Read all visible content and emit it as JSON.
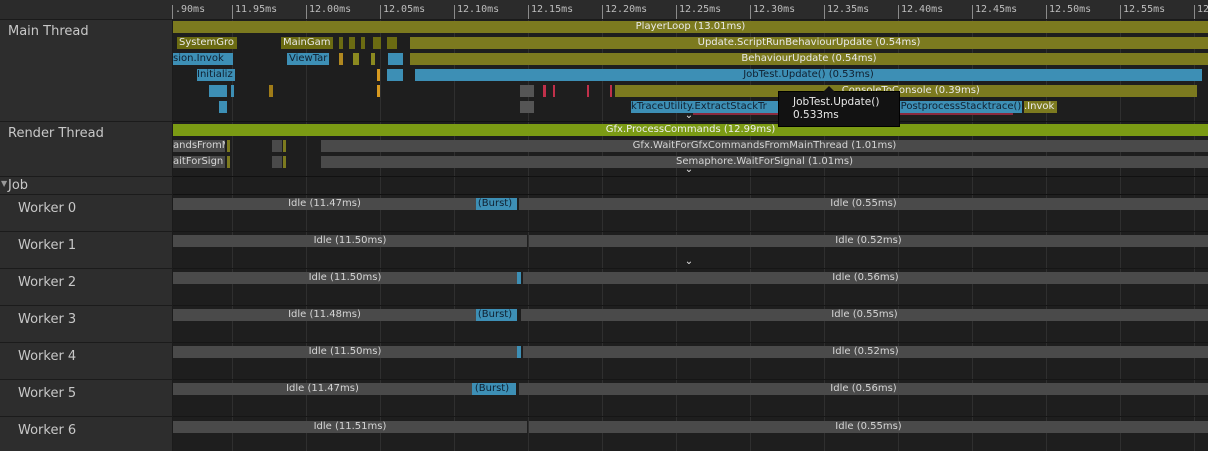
{
  "ruler": {
    "ticks": [
      ".90ms",
      "11.95ms",
      "12.00ms",
      "12.05ms",
      "12.10ms",
      "12.15ms",
      "12.20ms",
      "12.25ms",
      "12.30ms",
      "12.35ms",
      "12.40ms",
      "12.45ms",
      "12.50ms",
      "12.55ms",
      "12"
    ]
  },
  "threads": {
    "main": "Main Thread",
    "render": "Render Thread",
    "job_group": "Job",
    "workers": [
      "Worker 0",
      "Worker 1",
      "Worker 2",
      "Worker 3",
      "Worker 4",
      "Worker 5",
      "Worker 6"
    ]
  },
  "main_thread": {
    "player_loop": "PlayerLoop (13.01ms)",
    "script_run": "Update.ScriptRunBehaviourUpdate (0.54ms)",
    "behaviour_update": "BehaviourUpdate (0.54ms)",
    "job_test_update": "JobTest.Update() (0.53ms)",
    "log_console": "...ConsoleToConsole (0.39ms)",
    "extract_stack": "kTraceUtility.ExtractStackTr",
    "postprocess": "PostprocessStacktrace()",
    "invok_right": ".Invok",
    "system_gro": "SystemGro",
    "main_gam": "MainGam",
    "sion_invok": "sion.Invok",
    "view_tar": "ViewTar",
    "initializ": "Initializ"
  },
  "render_thread": {
    "process_commands": "Gfx.ProcessCommands (12.99ms)",
    "wait_for_commands": "Gfx.WaitForGfxCommandsFromMainThread (1.01ms)",
    "semaphore": "Semaphore.WaitForSignal (1.01ms)",
    "ands_from": "andsFromM",
    "ait_for_sign": "aitForSign"
  },
  "workers": [
    {
      "idle_left": "Idle (11.47ms)",
      "burst": "(Burst)",
      "idle_right": "Idle (0.55ms)"
    },
    {
      "idle_left": "Idle (11.50ms)",
      "burst": "",
      "idle_right": "Idle (0.52ms)"
    },
    {
      "idle_left": "Idle (11.50ms)",
      "burst": "",
      "idle_right": "Idle (0.56ms)"
    },
    {
      "idle_left": "Idle (11.48ms)",
      "burst": "(Burst)",
      "idle_right": "Idle (0.55ms)"
    },
    {
      "idle_left": "Idle (11.50ms)",
      "burst": "",
      "idle_right": "Idle (0.52ms)"
    },
    {
      "idle_left": "Idle (11.47ms)",
      "burst": "(Burst)",
      "idle_right": "Idle (0.56ms)"
    },
    {
      "idle_left": "Idle (11.51ms)",
      "burst": "",
      "idle_right": "Idle (0.55ms)"
    }
  ],
  "tooltip": {
    "name": "JobTest.Update()",
    "time": "0.533ms"
  },
  "icons": {
    "expand": "chevron-down-icon",
    "collapse_job": "triangle-down-icon"
  },
  "colors": {
    "player_loop": "#7c7a1f",
    "script": "#3d8fb5",
    "render": "#7b9b14",
    "idle": "#4a4a4a"
  }
}
